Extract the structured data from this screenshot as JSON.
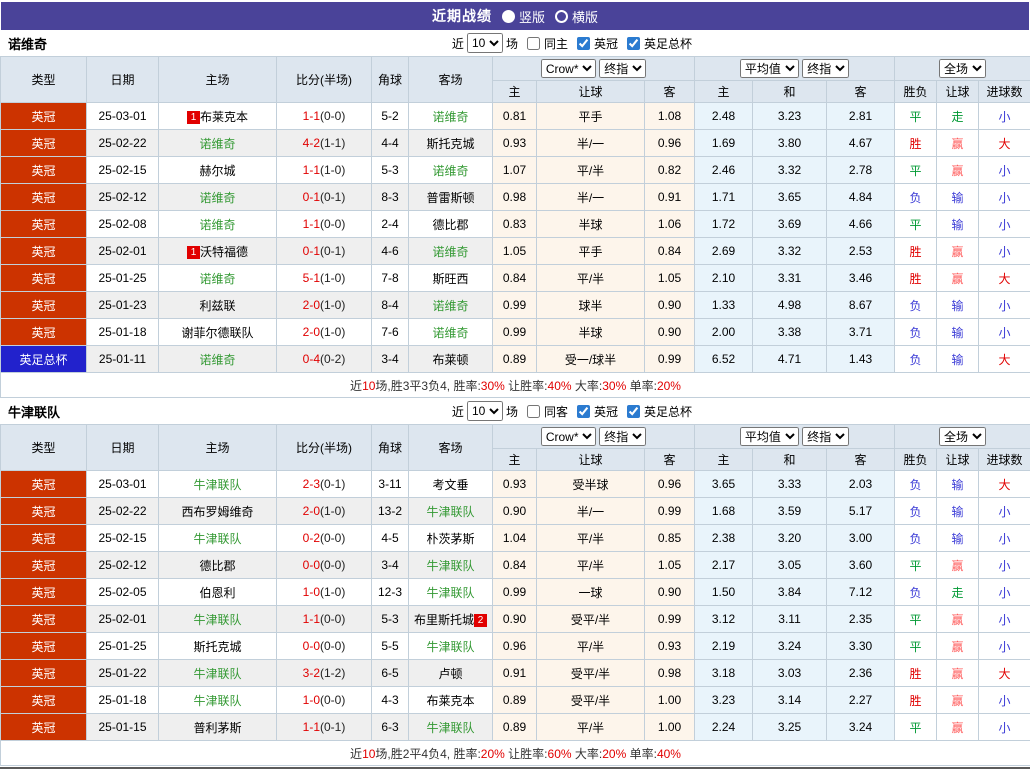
{
  "title_bar": {
    "title": "近期战绩",
    "radio_vertical": "竖版",
    "radio_horizontal": "横版",
    "selected": "竖版"
  },
  "colors": {
    "title_bar_bg": "#4a4399",
    "league_badge": "#cc3300",
    "cup_badge": "#2222cc",
    "self_team_green": "#339933",
    "score_red": "#e10000",
    "win_red": "#e10000",
    "lose_blue": "#3a3ad6",
    "draw_green": "#009933"
  },
  "columns": {
    "type": "类型",
    "date": "日期",
    "home": "主场",
    "score": "比分(半场)",
    "corner": "角球",
    "away": "客场",
    "asia_home": "主",
    "asia_handicap": "让球",
    "asia_away": "客",
    "eu_home": "主",
    "eu_draw": "和",
    "eu_away": "客",
    "res_outcome": "胜负",
    "res_handicap": "让球",
    "res_goals": "进球数"
  },
  "controls": {
    "bookmaker": "Crow*",
    "final": "终指",
    "average": "平均值",
    "final2": "终指",
    "full": "全场"
  },
  "sections": [
    {
      "team": "诺维奇",
      "filter": {
        "near": "近",
        "count": "10",
        "games": "场",
        "same": "同主",
        "same_checked": false,
        "league1": "英冠",
        "league1_checked": true,
        "league2": "英足总杯",
        "league2_checked": true
      },
      "rows": [
        {
          "t": "英冠",
          "cup": false,
          "d": "25-03-01",
          "h": {
            "n": "布莱克本",
            "self": false,
            "b1": "1"
          },
          "s": "1-1",
          "hf": "(0-0)",
          "c": "5-2",
          "a": {
            "n": "诺维奇",
            "self": true
          },
          "cr": [
            "0.81",
            "平手",
            "1.08"
          ],
          "av": [
            "2.48",
            "3.23",
            "2.81"
          ],
          "r": [
            [
              "平",
              "green"
            ],
            [
              "走",
              "green"
            ],
            [
              "小",
              "blue"
            ]
          ]
        },
        {
          "t": "英冠",
          "cup": false,
          "d": "25-02-22",
          "h": {
            "n": "诺维奇",
            "self": true
          },
          "s": "4-2",
          "hf": "(1-1)",
          "c": "4-4",
          "a": {
            "n": "斯托克城",
            "self": false
          },
          "cr": [
            "0.93",
            "半/一",
            "0.96"
          ],
          "av": [
            "1.69",
            "3.80",
            "4.67"
          ],
          "r": [
            [
              "胜",
              "red"
            ],
            [
              "赢",
              "pink"
            ],
            [
              "大",
              "red"
            ]
          ]
        },
        {
          "t": "英冠",
          "cup": false,
          "d": "25-02-15",
          "h": {
            "n": "赫尔城",
            "self": false
          },
          "s": "1-1",
          "hf": "(1-0)",
          "c": "5-3",
          "a": {
            "n": "诺维奇",
            "self": true
          },
          "cr": [
            "1.07",
            "平/半",
            "0.82"
          ],
          "av": [
            "2.46",
            "3.32",
            "2.78"
          ],
          "r": [
            [
              "平",
              "green"
            ],
            [
              "赢",
              "pink"
            ],
            [
              "小",
              "blue"
            ]
          ]
        },
        {
          "t": "英冠",
          "cup": false,
          "d": "25-02-12",
          "h": {
            "n": "诺维奇",
            "self": true
          },
          "s": "0-1",
          "hf": "(0-1)",
          "c": "8-3",
          "a": {
            "n": "普雷斯顿",
            "self": false
          },
          "cr": [
            "0.98",
            "半/一",
            "0.91"
          ],
          "av": [
            "1.71",
            "3.65",
            "4.84"
          ],
          "r": [
            [
              "负",
              "blue"
            ],
            [
              "输",
              "blue"
            ],
            [
              "小",
              "blue"
            ]
          ]
        },
        {
          "t": "英冠",
          "cup": false,
          "d": "25-02-08",
          "h": {
            "n": "诺维奇",
            "self": true
          },
          "s": "1-1",
          "hf": "(0-0)",
          "c": "2-4",
          "a": {
            "n": "德比郡",
            "self": false
          },
          "cr": [
            "0.83",
            "半球",
            "1.06"
          ],
          "av": [
            "1.72",
            "3.69",
            "4.66"
          ],
          "r": [
            [
              "平",
              "green"
            ],
            [
              "输",
              "blue"
            ],
            [
              "小",
              "blue"
            ]
          ]
        },
        {
          "t": "英冠",
          "cup": false,
          "d": "25-02-01",
          "h": {
            "n": "沃特福德",
            "self": false,
            "b1": "1"
          },
          "s": "0-1",
          "hf": "(0-1)",
          "c": "4-6",
          "a": {
            "n": "诺维奇",
            "self": true
          },
          "cr": [
            "1.05",
            "平手",
            "0.84"
          ],
          "av": [
            "2.69",
            "3.32",
            "2.53"
          ],
          "r": [
            [
              "胜",
              "red"
            ],
            [
              "赢",
              "pink"
            ],
            [
              "小",
              "blue"
            ]
          ]
        },
        {
          "t": "英冠",
          "cup": false,
          "d": "25-01-25",
          "h": {
            "n": "诺维奇",
            "self": true
          },
          "s": "5-1",
          "hf": "(1-0)",
          "c": "7-8",
          "a": {
            "n": "斯旺西",
            "self": false
          },
          "cr": [
            "0.84",
            "平/半",
            "1.05"
          ],
          "av": [
            "2.10",
            "3.31",
            "3.46"
          ],
          "r": [
            [
              "胜",
              "red"
            ],
            [
              "赢",
              "pink"
            ],
            [
              "大",
              "red"
            ]
          ]
        },
        {
          "t": "英冠",
          "cup": false,
          "d": "25-01-23",
          "h": {
            "n": "利兹联",
            "self": false
          },
          "s": "2-0",
          "hf": "(1-0)",
          "c": "8-4",
          "a": {
            "n": "诺维奇",
            "self": true
          },
          "cr": [
            "0.99",
            "球半",
            "0.90"
          ],
          "av": [
            "1.33",
            "4.98",
            "8.67"
          ],
          "r": [
            [
              "负",
              "blue"
            ],
            [
              "输",
              "blue"
            ],
            [
              "小",
              "blue"
            ]
          ]
        },
        {
          "t": "英冠",
          "cup": false,
          "d": "25-01-18",
          "h": {
            "n": "谢菲尔德联队",
            "self": false
          },
          "s": "2-0",
          "hf": "(1-0)",
          "c": "7-6",
          "a": {
            "n": "诺维奇",
            "self": true
          },
          "cr": [
            "0.99",
            "半球",
            "0.90"
          ],
          "av": [
            "2.00",
            "3.38",
            "3.71"
          ],
          "r": [
            [
              "负",
              "blue"
            ],
            [
              "输",
              "blue"
            ],
            [
              "小",
              "blue"
            ]
          ]
        },
        {
          "t": "英足总杯",
          "cup": true,
          "d": "25-01-11",
          "h": {
            "n": "诺维奇",
            "self": true
          },
          "s": "0-4",
          "hf": "(0-2)",
          "c": "3-4",
          "a": {
            "n": "布莱顿",
            "self": false
          },
          "cr": [
            "0.89",
            "受一/球半",
            "0.99"
          ],
          "av": [
            "6.52",
            "4.71",
            "1.43"
          ],
          "r": [
            [
              "负",
              "blue"
            ],
            [
              "输",
              "blue"
            ],
            [
              "大",
              "red"
            ]
          ]
        }
      ],
      "summary": {
        "near": "近",
        "games": "10",
        "record": "场,胜3平3负4,",
        "stats": [
          [
            "胜率:",
            "30%"
          ],
          [
            "让胜率:",
            "40%"
          ],
          [
            "大率:",
            "30%"
          ],
          [
            "单率:",
            "20%"
          ]
        ]
      }
    },
    {
      "team": "牛津联队",
      "filter": {
        "near": "近",
        "count": "10",
        "games": "场",
        "same": "同客",
        "same_checked": false,
        "league1": "英冠",
        "league1_checked": true,
        "league2": "英足总杯",
        "league2_checked": true
      },
      "rows": [
        {
          "t": "英冠",
          "cup": false,
          "d": "25-03-01",
          "h": {
            "n": "牛津联队",
            "self": true
          },
          "s": "2-3",
          "hf": "(0-1)",
          "c": "3-11",
          "a": {
            "n": "考文垂",
            "self": false
          },
          "cr": [
            "0.93",
            "受半球",
            "0.96"
          ],
          "av": [
            "3.65",
            "3.33",
            "2.03"
          ],
          "r": [
            [
              "负",
              "blue"
            ],
            [
              "输",
              "blue"
            ],
            [
              "大",
              "red"
            ]
          ]
        },
        {
          "t": "英冠",
          "cup": false,
          "d": "25-02-22",
          "h": {
            "n": "西布罗姆维奇",
            "self": false
          },
          "s": "2-0",
          "hf": "(1-0)",
          "c": "13-2",
          "a": {
            "n": "牛津联队",
            "self": true
          },
          "cr": [
            "0.90",
            "半/一",
            "0.99"
          ],
          "av": [
            "1.68",
            "3.59",
            "5.17"
          ],
          "r": [
            [
              "负",
              "blue"
            ],
            [
              "输",
              "blue"
            ],
            [
              "小",
              "blue"
            ]
          ]
        },
        {
          "t": "英冠",
          "cup": false,
          "d": "25-02-15",
          "h": {
            "n": "牛津联队",
            "self": true
          },
          "s": "0-2",
          "hf": "(0-0)",
          "c": "4-5",
          "a": {
            "n": "朴茨茅斯",
            "self": false
          },
          "cr": [
            "1.04",
            "平/半",
            "0.85"
          ],
          "av": [
            "2.38",
            "3.20",
            "3.00"
          ],
          "r": [
            [
              "负",
              "blue"
            ],
            [
              "输",
              "blue"
            ],
            [
              "小",
              "blue"
            ]
          ]
        },
        {
          "t": "英冠",
          "cup": false,
          "d": "25-02-12",
          "h": {
            "n": "德比郡",
            "self": false
          },
          "s": "0-0",
          "hf": "(0-0)",
          "c": "3-4",
          "a": {
            "n": "牛津联队",
            "self": true
          },
          "cr": [
            "0.84",
            "平/半",
            "1.05"
          ],
          "av": [
            "2.17",
            "3.05",
            "3.60"
          ],
          "r": [
            [
              "平",
              "green"
            ],
            [
              "赢",
              "pink"
            ],
            [
              "小",
              "blue"
            ]
          ]
        },
        {
          "t": "英冠",
          "cup": false,
          "d": "25-02-05",
          "h": {
            "n": "伯恩利",
            "self": false
          },
          "s": "1-0",
          "hf": "(1-0)",
          "c": "12-3",
          "a": {
            "n": "牛津联队",
            "self": true
          },
          "cr": [
            "0.99",
            "一球",
            "0.90"
          ],
          "av": [
            "1.50",
            "3.84",
            "7.12"
          ],
          "r": [
            [
              "负",
              "blue"
            ],
            [
              "走",
              "green"
            ],
            [
              "小",
              "blue"
            ]
          ]
        },
        {
          "t": "英冠",
          "cup": false,
          "d": "25-02-01",
          "h": {
            "n": "牛津联队",
            "self": true
          },
          "s": "1-1",
          "hf": "(0-0)",
          "c": "5-3",
          "a": {
            "n": "布里斯托城",
            "self": false,
            "b2": "2"
          },
          "cr": [
            "0.90",
            "受平/半",
            "0.99"
          ],
          "av": [
            "3.12",
            "3.11",
            "2.35"
          ],
          "r": [
            [
              "平",
              "green"
            ],
            [
              "赢",
              "pink"
            ],
            [
              "小",
              "blue"
            ]
          ]
        },
        {
          "t": "英冠",
          "cup": false,
          "d": "25-01-25",
          "h": {
            "n": "斯托克城",
            "self": false
          },
          "s": "0-0",
          "hf": "(0-0)",
          "c": "5-5",
          "a": {
            "n": "牛津联队",
            "self": true
          },
          "cr": [
            "0.96",
            "平/半",
            "0.93"
          ],
          "av": [
            "2.19",
            "3.24",
            "3.30"
          ],
          "r": [
            [
              "平",
              "green"
            ],
            [
              "赢",
              "pink"
            ],
            [
              "小",
              "blue"
            ]
          ]
        },
        {
          "t": "英冠",
          "cup": false,
          "d": "25-01-22",
          "h": {
            "n": "牛津联队",
            "self": true
          },
          "s": "3-2",
          "hf": "(1-2)",
          "c": "6-5",
          "a": {
            "n": "卢顿",
            "self": false
          },
          "cr": [
            "0.91",
            "受平/半",
            "0.98"
          ],
          "av": [
            "3.18",
            "3.03",
            "2.36"
          ],
          "r": [
            [
              "胜",
              "red"
            ],
            [
              "赢",
              "pink"
            ],
            [
              "大",
              "red"
            ]
          ]
        },
        {
          "t": "英冠",
          "cup": false,
          "d": "25-01-18",
          "h": {
            "n": "牛津联队",
            "self": true
          },
          "s": "1-0",
          "hf": "(0-0)",
          "c": "4-3",
          "a": {
            "n": "布莱克本",
            "self": false
          },
          "cr": [
            "0.89",
            "受平/半",
            "1.00"
          ],
          "av": [
            "3.23",
            "3.14",
            "2.27"
          ],
          "r": [
            [
              "胜",
              "red"
            ],
            [
              "赢",
              "pink"
            ],
            [
              "小",
              "blue"
            ]
          ]
        },
        {
          "t": "英冠",
          "cup": false,
          "d": "25-01-15",
          "h": {
            "n": "普利茅斯",
            "self": false
          },
          "s": "1-1",
          "hf": "(0-1)",
          "c": "6-3",
          "a": {
            "n": "牛津联队",
            "self": true
          },
          "cr": [
            "0.89",
            "平/半",
            "1.00"
          ],
          "av": [
            "2.24",
            "3.25",
            "3.24"
          ],
          "r": [
            [
              "平",
              "green"
            ],
            [
              "赢",
              "pink"
            ],
            [
              "小",
              "blue"
            ]
          ]
        }
      ],
      "summary": {
        "near": "近",
        "games": "10",
        "record": "场,胜2平4负4,",
        "stats": [
          [
            "胜率:",
            "20%"
          ],
          [
            "让胜率:",
            "60%"
          ],
          [
            "大率:",
            "20%"
          ],
          [
            "单率:",
            "40%"
          ]
        ]
      }
    }
  ]
}
